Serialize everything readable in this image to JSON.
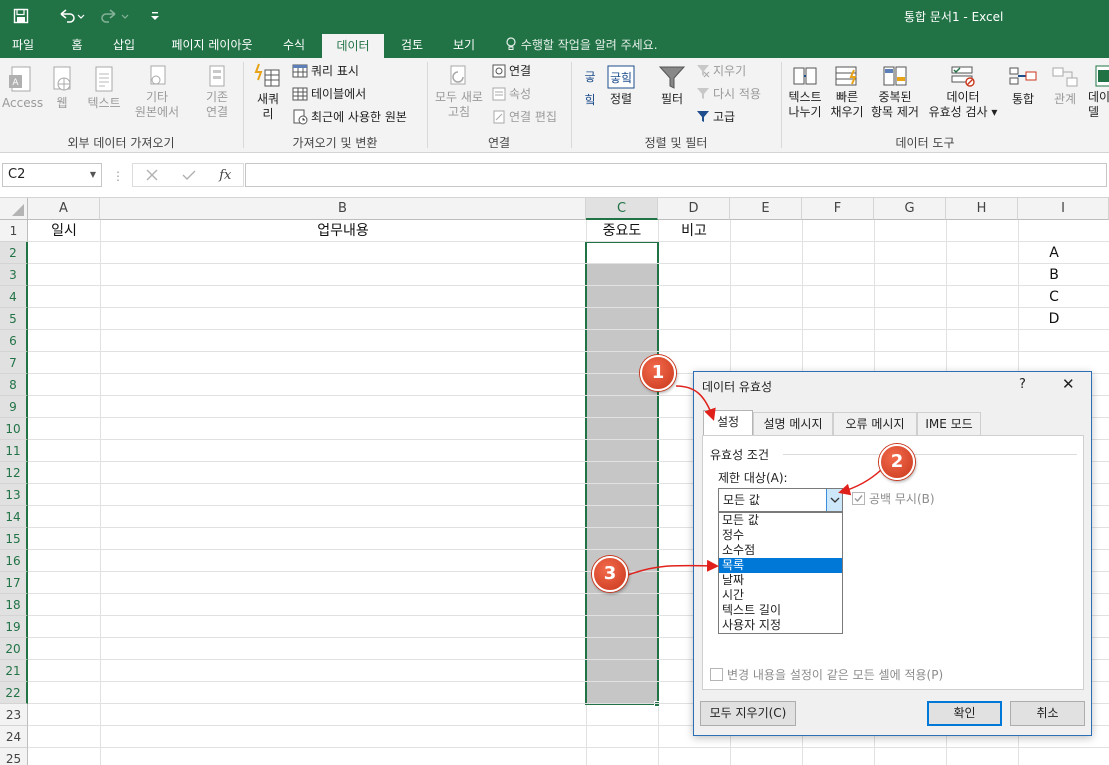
{
  "window": {
    "title": "통합 문서1 - Excel"
  },
  "quick_access": {
    "save": "save-icon",
    "undo": "undo-icon",
    "redo": "redo-icon",
    "customize": "customize-icon"
  },
  "tabs": [
    {
      "label": "파일"
    },
    {
      "label": "홈"
    },
    {
      "label": "삽입"
    },
    {
      "label": "페이지 레이아웃"
    },
    {
      "label": "수식"
    },
    {
      "label": "데이터"
    },
    {
      "label": "검토"
    },
    {
      "label": "보기"
    }
  ],
  "tell_me": "수행할 작업을 알려 주세요.",
  "ribbon": {
    "access": "Access",
    "web": "웹",
    "text": "텍스트",
    "other_1": "기타",
    "other_2": "원본에서",
    "existing_1": "기존",
    "existing_2": "연결",
    "new_query_1": "새쿼",
    "new_query_2": "리",
    "show_queries": "쿼리 표시",
    "from_table": "테이블에서",
    "recent_sources": "최근에 사용한 원본",
    "refresh_1": "모두 새로",
    "refresh_2": "고침",
    "connections": "연결",
    "properties": "속성",
    "edit_links": "연결 편집",
    "sort": "정렬",
    "filter": "필터",
    "clear": "지우기",
    "reapply": "다시 적용",
    "advanced": "고급",
    "text_to_cols_1": "텍스트",
    "text_to_cols_2": "나누기",
    "flash_fill_1": "빠른",
    "flash_fill_2": "채우기",
    "remove_dup_1": "중복된",
    "remove_dup_2": "항목 제거",
    "validation_1": "데이터",
    "validation_2": "유효성 검사",
    "consolidate": "통합",
    "relations": "관계",
    "data_model_1": "데이",
    "data_model_2": "델",
    "groups": {
      "external": "외부 데이터 가져오기",
      "transform": "가져오기 및 변환",
      "connections": "연결",
      "sort_filter": "정렬 및 필터",
      "data_tools": "데이터 도구"
    }
  },
  "formula_bar": {
    "name_box": "C2",
    "formula": ""
  },
  "columns": [
    "A",
    "B",
    "C",
    "D",
    "E",
    "F",
    "G",
    "H",
    "I"
  ],
  "rows": [
    "1",
    "2",
    "3",
    "4",
    "5",
    "6",
    "7",
    "8",
    "9",
    "10",
    "11",
    "12",
    "13",
    "14",
    "15",
    "16",
    "17",
    "18",
    "19",
    "20",
    "21",
    "22",
    "23",
    "24",
    "25"
  ],
  "cells": {
    "A1": "일시",
    "B1": "업무내용",
    "C1": "중요도",
    "D1": "비고",
    "I2": "A",
    "I3": "B",
    "I4": "C",
    "I5": "D"
  },
  "dialog": {
    "title": "데이터 유효성",
    "help": "?",
    "tabs": [
      {
        "label": "설정"
      },
      {
        "label": "설명 메시지"
      },
      {
        "label": "오류 메시지"
      },
      {
        "label": "IME 모드"
      }
    ],
    "section": "유효성 조건",
    "allow_label": "제한 대상(A):",
    "allow_value": "모든 값",
    "ignore_blank": "공백 무시(B)",
    "options": [
      "모든 값",
      "정수",
      "소수점",
      "목록",
      "날짜",
      "시간",
      "텍스트 길이",
      "사용자 지정"
    ],
    "apply_all": "변경 내용을 설정이 같은 모든 셀에 적용(P)",
    "clear_all": "모두 지우기(C)",
    "ok": "확인",
    "cancel": "취소"
  },
  "callouts": [
    "1",
    "2",
    "3"
  ],
  "colors": {
    "accent": "#217346",
    "callout": "#d9432a",
    "selection": "#0078d7"
  }
}
